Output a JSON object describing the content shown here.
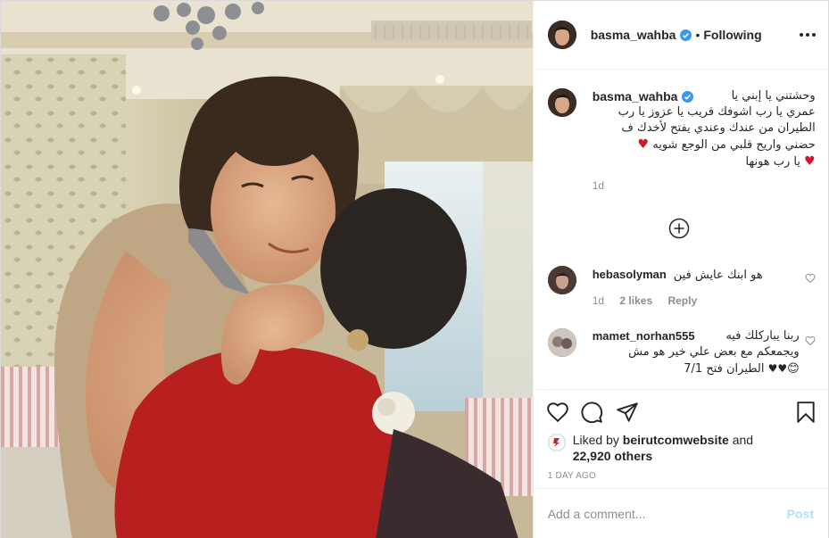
{
  "post": {
    "author": "basma_wahba",
    "follow_separator": "•",
    "follow_status": "Following",
    "caption_lines": [
      "وحشتني يا إبني يا",
      "عمري يا رب اشوفك قريب يا عزوز يا رب",
      "الطيران من عندك وعندي يفتح لأخدك ف",
      "حضني واريح قلبي من الوجع شويه",
      "يا رب هونها"
    ],
    "caption_time": "1d",
    "comments": [
      {
        "user": "hebasolyman",
        "text": "هو ابنك عايش فين",
        "time": "1d",
        "likes": "2 likes",
        "reply": "Reply"
      },
      {
        "user": "mamet_norhan555",
        "text_lines": [
          "ربنا يباركلك فيه",
          "ويجمعكم مع بعض علي خير هو مش",
          "الطيران فتح 7/1"
        ]
      }
    ],
    "liked_by_prefix": "Liked by",
    "liked_by_user": "beirutcomwebsite",
    "liked_by_and": "and",
    "liked_by_others": "22,920 others",
    "time_ago": "1 DAY AGO",
    "add_comment_placeholder": "Add a comment...",
    "post_button": "Post"
  },
  "colors": {
    "verified": "#3897f0",
    "heart": "#d1162a",
    "post_button_disabled": "#b2dffc",
    "secondary_text": "#8e8e8e"
  }
}
